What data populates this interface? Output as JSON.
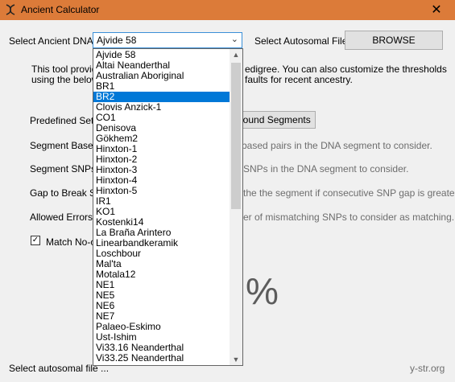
{
  "window": {
    "title": "Ancient Calculator",
    "close_glyph": "✕"
  },
  "dna_label": "Select Ancient DNA",
  "dna_selected": "Ajvide 58",
  "autosomal_label": "Select Autosomal File",
  "browse_label": "BROWSE",
  "description": {
    "line1_start": "This tool provide",
    "line1_end": "edigree. You can also customize the thresholds",
    "line2_start": "using the below",
    "line2_end": "faults for recent ancestry."
  },
  "predefined_label": "Predefined Settin",
  "compound_button": "pound Segments",
  "settings": [
    {
      "label": "Segment Base-p",
      "hint": "based pairs in the DNA segment to consider."
    },
    {
      "label": "Segment SNPs",
      "hint": "SNPs in the DNA segment to consider."
    },
    {
      "label": "Gap to Break Se",
      "hint": "the the segment if consecutive SNP gap is  greater."
    },
    {
      "label": "Allowed Errors",
      "hint": "er of mismatching SNPs to consider as matching."
    }
  ],
  "match_label": "Match No-ca",
  "match_checked_glyph": "✓",
  "percent_text": "%",
  "status_left": "Select autosomal file ...",
  "status_right": "y-str.org",
  "dropdown": {
    "items": [
      "Ajvide 58",
      "Altai Neanderthal",
      "Australian Aboriginal",
      "BR1",
      "BR2",
      "Clovis Anzick-1",
      "CO1",
      "Denisova",
      "Gökhem2",
      "Hinxton-1",
      "Hinxton-2",
      "Hinxton-3",
      "Hinxton-4",
      "Hinxton-5",
      "IR1",
      "KO1",
      "Kostenki14",
      "La Braña Arintero",
      "Linearbandkeramik",
      "Loschbour",
      "Mal'ta",
      "Motala12",
      "NE1",
      "NE5",
      "NE6",
      "NE7",
      "Palaeo-Eskimo",
      "Ust-Ishim",
      "Vi33.16 Neanderthal",
      "Vi33.25 Neanderthal"
    ],
    "selected_index": 4
  },
  "colors": {
    "titlebar": "#dc7b39",
    "selection": "#0078d7"
  }
}
